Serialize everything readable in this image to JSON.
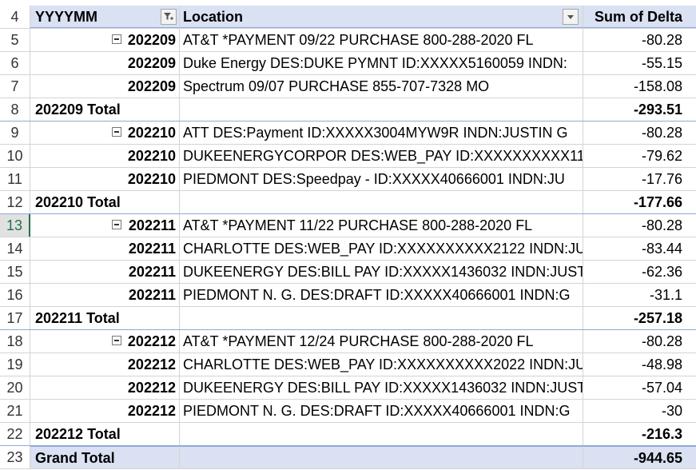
{
  "header": {
    "row_num": "4",
    "col_a": "YYYYMM",
    "col_b": "Location",
    "col_c": "Sum of Delta"
  },
  "rows": [
    {
      "n": "5",
      "type": "detail",
      "ym": "202209",
      "loc": "AT&T *PAYMENT 09/22 PURCHASE 800-288-2020 FL",
      "val": "-80.28",
      "collapse": true
    },
    {
      "n": "6",
      "type": "detail",
      "ym": "202209",
      "loc": "Duke Energy DES:DUKE PYMNT ID:XXXXX5160059 INDN:",
      "val": "-55.15"
    },
    {
      "n": "7",
      "type": "detail",
      "ym": "202209",
      "loc": "Spectrum 09/07 PURCHASE 855-707-7328 MO",
      "val": "-158.08"
    },
    {
      "n": "8",
      "type": "total",
      "label": "202209 Total",
      "val": "-293.51"
    },
    {
      "n": "9",
      "type": "detail",
      "ym": "202210",
      "loc": "ATT DES:Payment ID:XXXXX3004MYW9R INDN:JUSTIN G",
      "val": "-80.28",
      "collapse": true
    },
    {
      "n": "10",
      "type": "detail",
      "ym": "202210",
      "loc": "DUKEENERGYCORPOR DES:WEB_PAY ID:XXXXXXXXXX11",
      "val": "-79.62"
    },
    {
      "n": "11",
      "type": "detail",
      "ym": "202210",
      "loc": "PIEDMONT DES:Speedpay - ID:XXXXX40666001 INDN:JU",
      "val": "-17.76"
    },
    {
      "n": "12",
      "type": "total",
      "label": "202210 Total",
      "val": "-177.66"
    },
    {
      "n": "13",
      "type": "detail",
      "ym": "202211",
      "loc": "AT&T *PAYMENT 11/22 PURCHASE 800-288-2020 FL",
      "val": "-80.28",
      "collapse": true,
      "selected": true
    },
    {
      "n": "14",
      "type": "detail",
      "ym": "202211",
      "loc": "CHARLOTTE DES:WEB_PAY ID:XXXXXXXXXX2122 INDN:JU",
      "val": "-83.44"
    },
    {
      "n": "15",
      "type": "detail",
      "ym": "202211",
      "loc": "DUKEENERGY DES:BILL PAY ID:XXXXX1436032 INDN:JUST",
      "val": "-62.36"
    },
    {
      "n": "16",
      "type": "detail",
      "ym": "202211",
      "loc": "PIEDMONT N. G. DES:DRAFT ID:XXXXX40666001 INDN:G",
      "val": "-31.1"
    },
    {
      "n": "17",
      "type": "total",
      "label": "202211 Total",
      "val": "-257.18"
    },
    {
      "n": "18",
      "type": "detail",
      "ym": "202212",
      "loc": "AT&T *PAYMENT 12/24 PURCHASE 800-288-2020 FL",
      "val": "-80.28",
      "collapse": true
    },
    {
      "n": "19",
      "type": "detail",
      "ym": "202212",
      "loc": "CHARLOTTE DES:WEB_PAY ID:XXXXXXXXXX2022 INDN:JU",
      "val": "-48.98"
    },
    {
      "n": "20",
      "type": "detail",
      "ym": "202212",
      "loc": "DUKEENERGY DES:BILL PAY ID:XXXXX1436032 INDN:JUST",
      "val": "-57.04"
    },
    {
      "n": "21",
      "type": "detail",
      "ym": "202212",
      "loc": "PIEDMONT N. G. DES:DRAFT ID:XXXXX40666001 INDN:G",
      "val": "-30"
    },
    {
      "n": "22",
      "type": "total",
      "label": "202212 Total",
      "val": "-216.3"
    },
    {
      "n": "23",
      "type": "grand",
      "label": "Grand Total",
      "val": "-944.65"
    }
  ],
  "colors": {
    "header_fill": "#d9e1f2",
    "selected_row": "#217346"
  },
  "icons": {
    "filter_button": "filter-funnel-icon",
    "dropdown_button": "dropdown-arrow-icon",
    "collapse": "minus-box-icon"
  }
}
